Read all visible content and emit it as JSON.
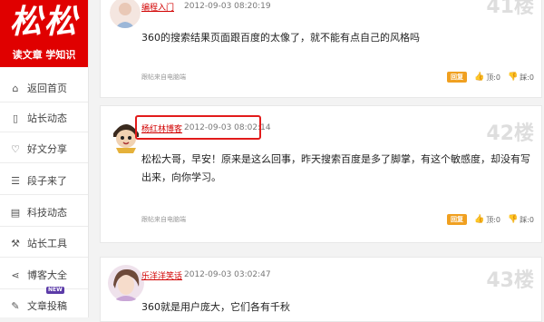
{
  "sidebar": {
    "logo_text": "松松",
    "tagline": "读文章 学知识",
    "items": [
      {
        "label": "返回首页",
        "icon": "home-icon",
        "glyph": "⌂"
      },
      {
        "label": "站长动态",
        "icon": "phone-icon",
        "glyph": "▯"
      },
      {
        "label": "好文分享",
        "icon": "heart-icon",
        "glyph": "♡"
      },
      {
        "label": "段子来了",
        "icon": "list-icon",
        "glyph": "☰"
      },
      {
        "label": "科技动态",
        "icon": "document-icon",
        "glyph": "▤"
      },
      {
        "label": "站长工具",
        "icon": "wrench-icon",
        "glyph": "⚒"
      },
      {
        "label": "博客大全",
        "icon": "share-icon",
        "glyph": "⋖"
      },
      {
        "label": "文章投稿",
        "icon": "edit-icon",
        "glyph": "✎",
        "badge": "NEW"
      }
    ]
  },
  "comments": [
    {
      "author": "编程入门",
      "time": "2012-09-03 08:20:19",
      "floor": "41楼",
      "text": "360的搜索结果页面跟百度的太像了，就不能有点自己的风格吗",
      "source": "跟帖来自电脑端",
      "reply_label": "回复",
      "up_label": "顶:0",
      "down_label": "踩:0"
    },
    {
      "author": "杨红林博客",
      "time": "2012-09-03 08:02:14",
      "floor": "42楼",
      "text": "松松大哥，早安！原来是这么回事，昨天搜索百度是多了脚掌，有这个敏感度，却没有写出来，向你学习。",
      "source": "跟帖来自电脑端",
      "reply_label": "回复",
      "up_label": "顶:0",
      "down_label": "踩:0"
    },
    {
      "author": "乐洋洋笑话",
      "time": "2012-09-03 03:02:47",
      "floor": "43楼",
      "text": "360就是用户庞大，它们各有千秋"
    }
  ],
  "colors": {
    "brand_red": "#e00000",
    "author_red": "#d10000",
    "reply_orange": "#f0a020",
    "highlight_red": "#e21b1b"
  }
}
